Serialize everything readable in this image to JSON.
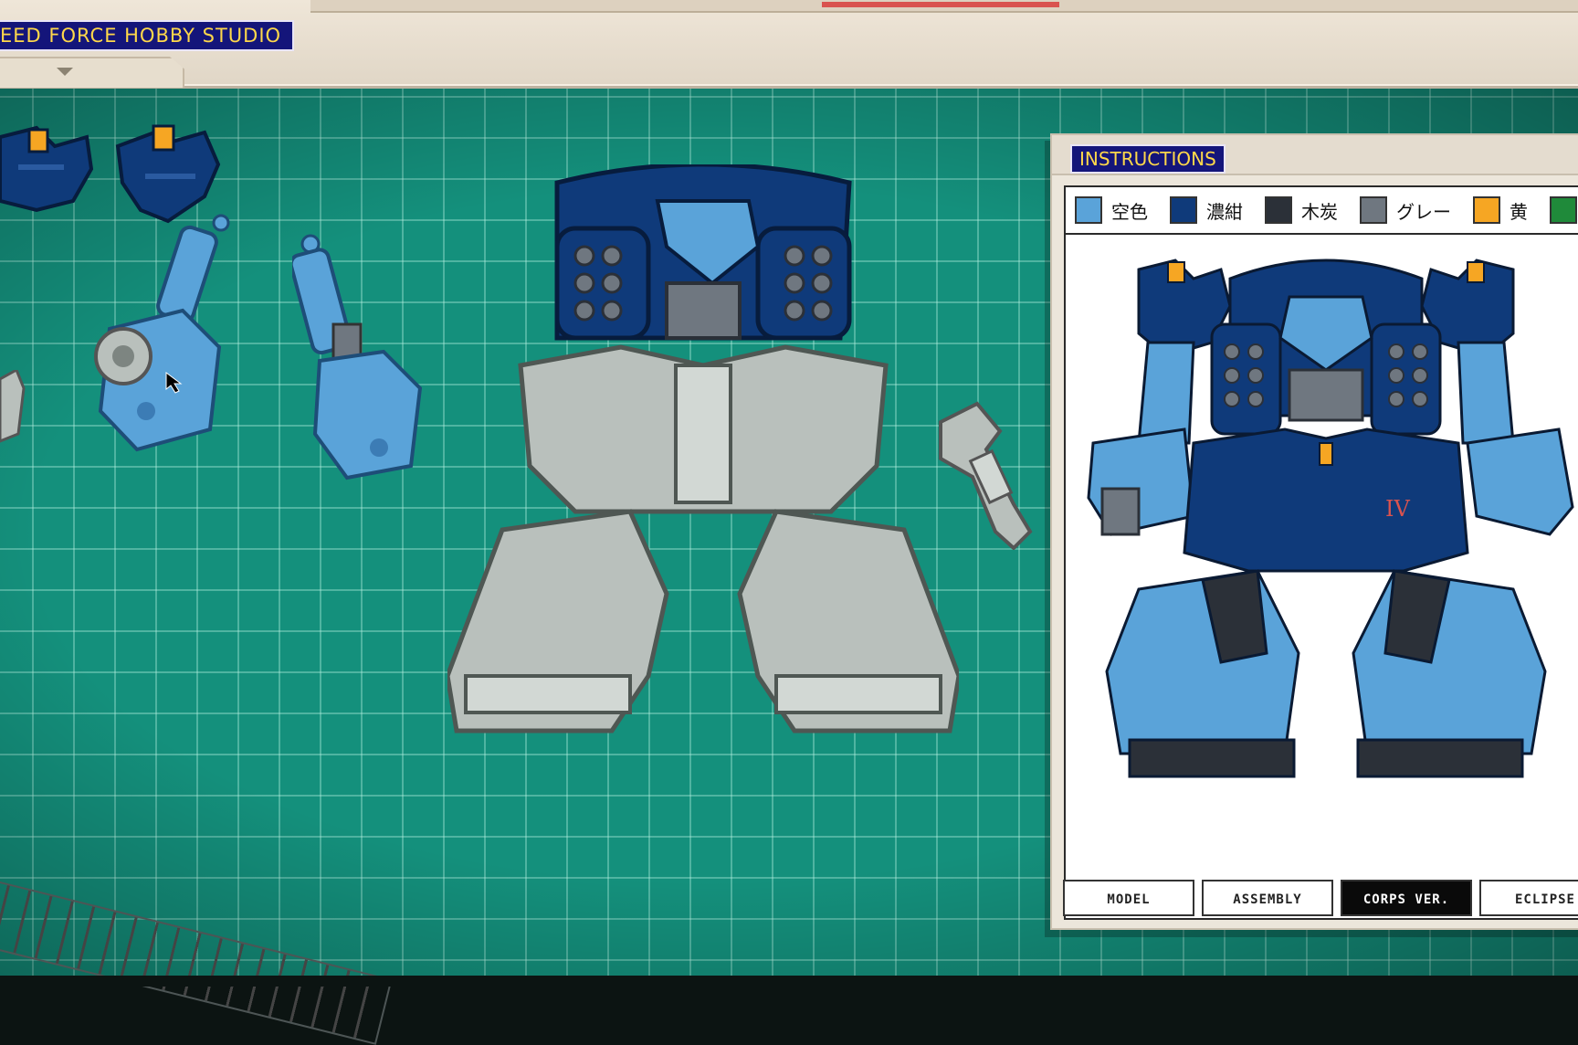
{
  "header": {
    "title": "EED FORCE HOBBY STUDIO"
  },
  "instructions": {
    "title": "INSTRUCTIONS",
    "legend": [
      {
        "label": "空色",
        "color": "#5aa3d9"
      },
      {
        "label": "濃紺",
        "color": "#0f3a7a"
      },
      {
        "label": "木炭",
        "color": "#2b3038"
      },
      {
        "label": "グレー",
        "color": "#6f7780"
      },
      {
        "label": "黄",
        "color": "#f6a623"
      },
      {
        "label": "",
        "color": "#1f8a3a"
      }
    ],
    "emblem": "IV",
    "tabs": [
      {
        "label": "MODEL",
        "active": false
      },
      {
        "label": "ASSEMBLY",
        "active": false
      },
      {
        "label": "CORPS VER.",
        "active": true
      },
      {
        "label": "ECLIPSE",
        "active": false
      }
    ]
  },
  "colors": {
    "mat": "#14907c",
    "title_bg": "#14157a",
    "title_text": "#ffd84a",
    "part_light_blue": "#5aa3d9",
    "part_navy": "#0f3a7a",
    "part_grey": "#b9c0bc"
  }
}
